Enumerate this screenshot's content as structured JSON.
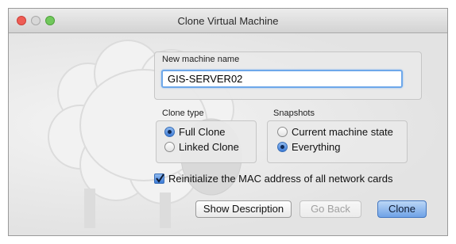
{
  "window": {
    "title": "Clone Virtual Machine",
    "controls": {
      "close": "close-icon",
      "minimize": "minimize-icon",
      "maximize": "maximize-icon"
    }
  },
  "machine_name": {
    "label": "New machine name",
    "value": "GIS-SERVER02"
  },
  "clone_type": {
    "label": "Clone type",
    "options": [
      {
        "label": "Full Clone",
        "selected": true
      },
      {
        "label": "Linked Clone",
        "selected": false
      }
    ]
  },
  "snapshots": {
    "label": "Snapshots",
    "options": [
      {
        "label": "Current machine state",
        "selected": false
      },
      {
        "label": "Everything",
        "selected": true
      }
    ]
  },
  "reinit_mac": {
    "label": "Reinitialize the MAC address of all network cards",
    "checked": true
  },
  "buttons": {
    "show_description": "Show Description",
    "go_back": "Go Back",
    "clone": "Clone"
  },
  "colors": {
    "accent": "#3d7bd6",
    "close": "#ee5d55",
    "maximize": "#71c85c"
  }
}
